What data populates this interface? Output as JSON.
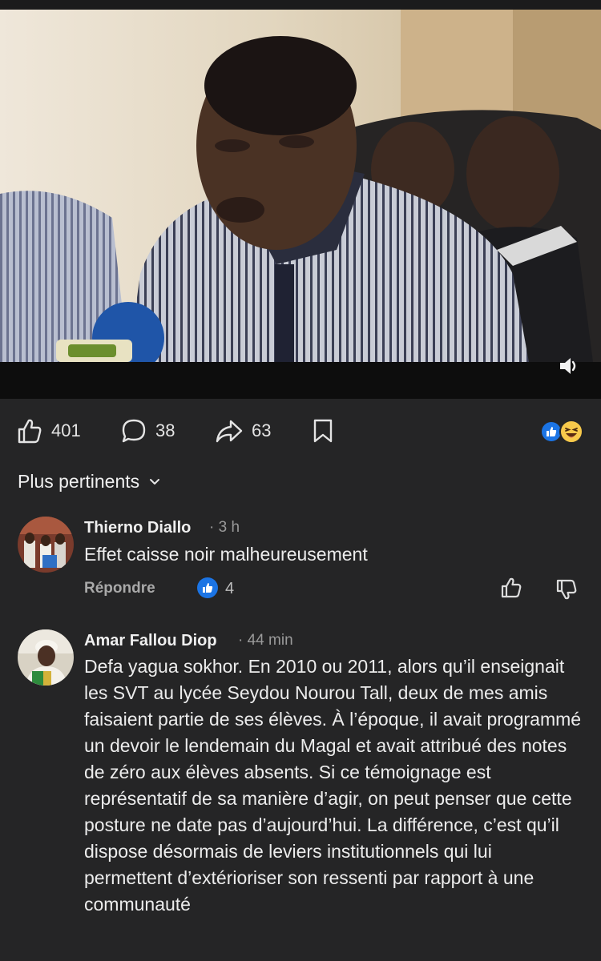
{
  "post": {
    "likes": "401",
    "comments": "38",
    "shares": "63"
  },
  "icons": {
    "like": "thumbs-up-outline-icon",
    "comment": "speech-bubble-icon",
    "share": "share-arrow-icon",
    "save": "bookmark-icon",
    "volume": "speaker-icon",
    "sort": "chevron-down-icon",
    "upvote": "thumbs-up-outline-icon",
    "downvote": "thumbs-down-outline-icon"
  },
  "colors": {
    "background": "#252526",
    "accent": "#1b74e4",
    "haha": "#f7c94b",
    "muted_text": "#9a9a9a"
  },
  "sort": {
    "label": "Plus pertinents"
  },
  "comments": [
    {
      "author": "Thierno Diallo",
      "time": "· 3 h",
      "text": "Effet caisse noir malheureusement",
      "reply_label": "Répondre",
      "reaction_count": "4"
    },
    {
      "author": "Amar Fallou Diop",
      "time": "· 44 min",
      "text": "Defa yagua sokhor. En 2010 ou 2011, alors qu’il enseignait les SVT au lycée Seydou Nourou Tall, deux de mes amis faisaient partie de ses élèves. À l’époque, il avait programmé un devoir le lendemain du Magal et avait attribué des notes de zéro aux élèves absents. Si ce témoignage est représentatif de sa manière d’agir, on peut penser que cette posture ne date pas d’aujourd’hui. La différence, c’est qu’il dispose désormais de leviers institutionnels qui lui permettent d’extérioriser son ressenti par rapport à une communauté"
    }
  ]
}
